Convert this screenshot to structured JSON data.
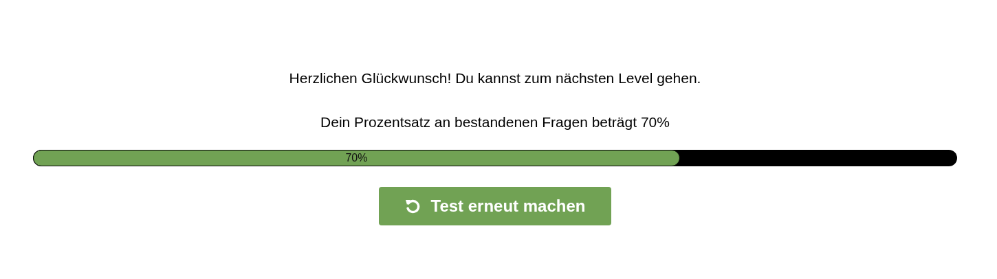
{
  "message": "Herzlichen Glückwunsch! Du kannst zum nächsten Level gehen.",
  "score_text": "Dein Prozentsatz an bestandenen Fragen beträgt 70%",
  "progress": {
    "level": 0.7,
    "label": "70%"
  },
  "retry_button": {
    "label": "Test erneut machen"
  }
}
